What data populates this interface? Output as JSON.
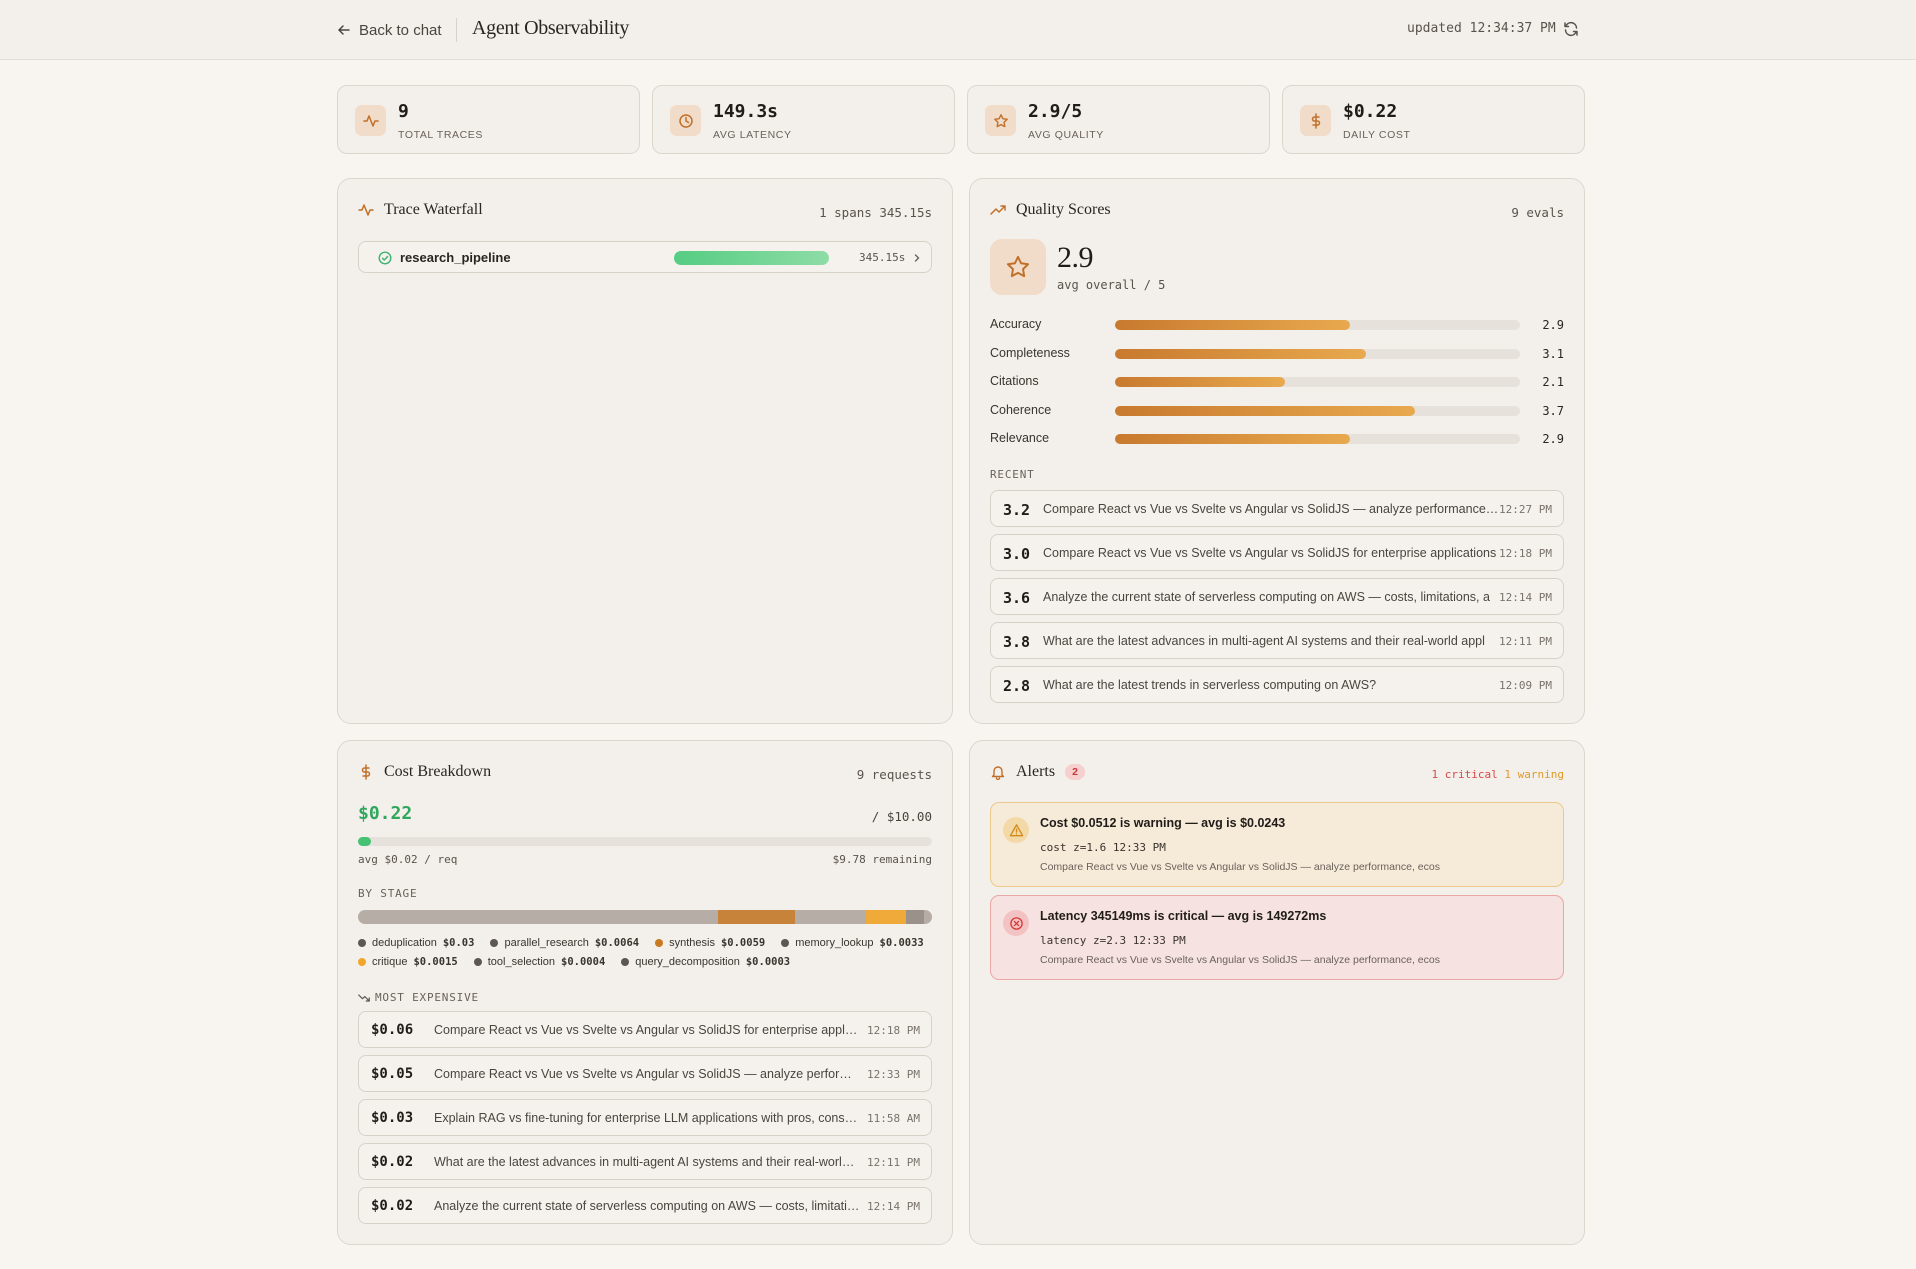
{
  "header": {
    "back_label": "Back to chat",
    "title": "Agent Observability",
    "updated": "updated 12:34:37 PM"
  },
  "stats": [
    {
      "value": "9",
      "label": "Total traces",
      "icon": "activity-icon"
    },
    {
      "value": "149.3s",
      "label": "Avg latency",
      "icon": "clock-icon"
    },
    {
      "value": "2.9/5",
      "label": "Avg quality",
      "icon": "star-icon"
    },
    {
      "value": "$0.22",
      "label": "Daily cost",
      "icon": "dollar-icon"
    }
  ],
  "waterfall": {
    "title": "Trace Waterfall",
    "meta": "1 spans  345.15s",
    "spans": [
      {
        "name": "research_pipeline",
        "duration": "345.15s",
        "fill": 1.0
      }
    ]
  },
  "quality": {
    "title": "Quality Scores",
    "meta": "9 evals",
    "overall": "2.9",
    "overall_sub": "avg overall / 5",
    "metrics": [
      {
        "label": "Accuracy",
        "value": 2.9,
        "display": "2.9"
      },
      {
        "label": "Completeness",
        "value": 3.1,
        "display": "3.1"
      },
      {
        "label": "Citations",
        "value": 2.1,
        "display": "2.1"
      },
      {
        "label": "Coherence",
        "value": 3.7,
        "display": "3.7"
      },
      {
        "label": "Relevance",
        "value": 2.9,
        "display": "2.9"
      }
    ],
    "recent_label": "RECENT",
    "recent": [
      {
        "score": "3.2",
        "text": "Compare React vs Vue vs Svelte vs Angular vs SolidJS — analyze performance, ecosystem",
        "time": "12:27 PM"
      },
      {
        "score": "3.0",
        "text": "Compare React vs Vue vs Svelte vs Angular vs SolidJS for enterprise applications",
        "time": "12:18 PM"
      },
      {
        "score": "3.6",
        "text": "Analyze the current state of serverless computing on AWS — costs, limitations, a",
        "time": "12:14 PM"
      },
      {
        "score": "3.8",
        "text": "What are the latest advances in multi-agent AI systems and their real-world appl",
        "time": "12:11 PM"
      },
      {
        "score": "2.8",
        "text": "What are the latest trends in serverless computing on AWS?",
        "time": "12:09 PM"
      }
    ]
  },
  "cost": {
    "title": "Cost Breakdown",
    "meta": "9 requests",
    "total": "$0.22",
    "budget": "/ $10.00",
    "used_fraction": 0.022,
    "avg": "avg $0.02 / req",
    "remaining": "$9.78 remaining",
    "by_stage_label": "BY STAGE",
    "stages": [
      {
        "name": "deduplication",
        "value": "$0.03",
        "amount": 0.03,
        "color": "#b5ada6",
        "dot": "#5e5650"
      },
      {
        "name": "parallel_research",
        "value": "$0.0064",
        "amount": 0.0064,
        "color": "#c8833a",
        "dot": "#5e5650"
      },
      {
        "name": "synthesis",
        "value": "$0.0059",
        "amount": 0.0059,
        "color": "#b5ada6",
        "dot": "#c87a22"
      },
      {
        "name": "memory_lookup",
        "value": "$0.0033",
        "amount": 0.0033,
        "color": "#f0aa3a",
        "dot": "#5e5650"
      },
      {
        "name": "critique",
        "value": "$0.0015",
        "amount": 0.0015,
        "color": "#9a928a",
        "dot": "#f0a62a"
      },
      {
        "name": "tool_selection",
        "value": "$0.0004",
        "amount": 0.0004,
        "color": "#b5ada6",
        "dot": "#5e5650"
      },
      {
        "name": "query_decomposition",
        "value": "$0.0003",
        "amount": 0.0003,
        "color": "#b5ada6",
        "dot": "#5e5650"
      }
    ],
    "expensive_label": "MOST EXPENSIVE",
    "expensive": [
      {
        "amount": "$0.06",
        "text": "Compare React vs Vue vs Svelte vs Angular vs SolidJS for enterprise applications",
        "time": "12:18 PM"
      },
      {
        "amount": "$0.05",
        "text": "Compare React vs Vue vs Svelte vs Angular vs SolidJS — analyze performance, ecosystem",
        "time": "12:33 PM"
      },
      {
        "amount": "$0.03",
        "text": "Explain RAG vs fine-tuning for enterprise LLM applications with pros, cons, and costs",
        "time": "11:58 AM"
      },
      {
        "amount": "$0.02",
        "text": "What are the latest advances in multi-agent AI systems and their real-world applications",
        "time": "12:11 PM"
      },
      {
        "amount": "$0.02",
        "text": "Analyze the current state of serverless computing on AWS — costs, limitations, and use cases",
        "time": "12:14 PM"
      }
    ]
  },
  "alerts": {
    "title": "Alerts",
    "count": "2",
    "critical": "1 critical",
    "warning": "1 warning",
    "items": [
      {
        "level": "warning",
        "title": "Cost $0.0512 is warning — avg is $0.0243",
        "meta": "cost  z=1.6  12:33 PM",
        "desc": "Compare React vs Vue vs Svelte vs Angular vs SolidJS — analyze performance, ecos"
      },
      {
        "level": "critical",
        "title": "Latency 345149ms is critical — avg is 149272ms",
        "meta": "latency  z=2.3  12:33 PM",
        "desc": "Compare React vs Vue vs Svelte vs Angular vs SolidJS — analyze performance, ecos"
      }
    ]
  }
}
